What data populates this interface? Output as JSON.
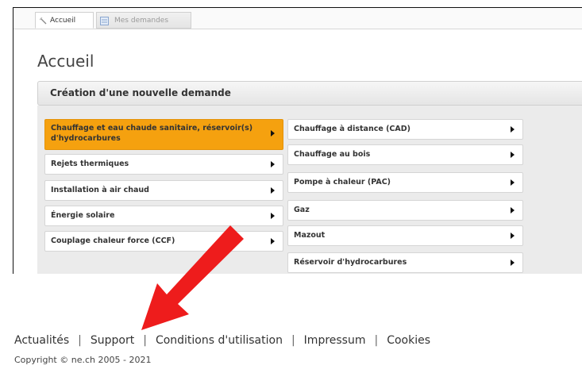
{
  "tabs": [
    {
      "label": "Accueil",
      "active": true
    },
    {
      "label": "Mes demandes",
      "active": false
    }
  ],
  "page": {
    "title": "Accueil"
  },
  "section": {
    "title": "Création d'une nouvelle demande"
  },
  "left_menu": [
    "Chauffage et eau chaude sanitaire, réservoir(s) d'hydrocarbures",
    "Rejets thermiques",
    "Installation à air chaud",
    "Énergie solaire",
    "Couplage chaleur force (CCF)"
  ],
  "right_menu": [
    "Chauffage à distance (CAD)",
    "Chauffage au bois",
    "Pompe à chaleur (PAC)",
    "Gaz",
    "Mazout",
    "Réservoir d'hydrocarbures"
  ],
  "footer": {
    "links": [
      "Actualités",
      "Support",
      "Conditions d'utilisation",
      "Impressum",
      "Cookies"
    ],
    "separator": "|",
    "copyright": "Copyright © ne.ch 2005 - 2021"
  },
  "colors": {
    "selected_item": "#f5a10f",
    "annotation_arrow": "#ee1c1c"
  }
}
